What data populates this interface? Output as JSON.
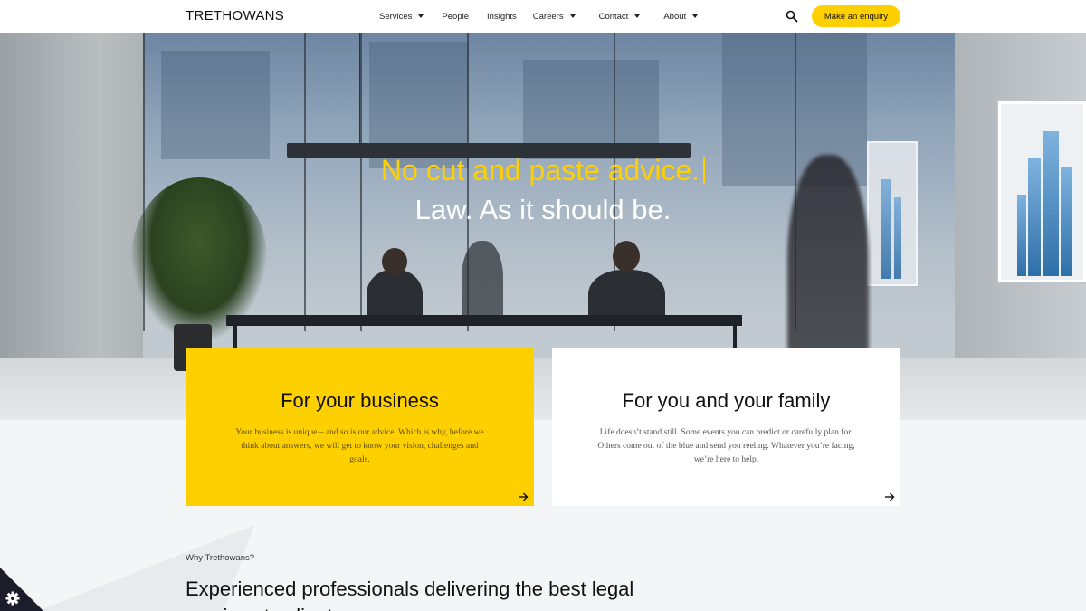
{
  "header": {
    "logo": "TRETHOWANS",
    "nav": [
      {
        "label": "Services",
        "dropdown": true
      },
      {
        "label": "People",
        "dropdown": false
      },
      {
        "label": "Insights",
        "dropdown": false
      },
      {
        "label": "Careers",
        "dropdown": true
      },
      {
        "label": "Contact",
        "dropdown": true
      },
      {
        "label": "About",
        "dropdown": true
      }
    ],
    "search_icon": "search-icon",
    "cta_label": "Make an enquiry"
  },
  "hero": {
    "line1": "No cut and paste advice.",
    "line2": "Law. As it should be."
  },
  "cards": {
    "business": {
      "title": "For your business",
      "text": "Your business is unique – and so is our advice. Which is why, before we think about answers, we will get to know your vision, challenges and goals."
    },
    "family": {
      "title": "For you and your family",
      "text": "Life doesn’t stand still. Some events you can predict or carefully plan for. Others come out of the blue and send you reeling. Whatever you’re facing, we’re here to help."
    }
  },
  "why": {
    "label": "Why Trethowans?",
    "heading": "Experienced professionals delivering the best legal services to clients"
  },
  "colors": {
    "accent": "#ffd000",
    "dark": "#111111",
    "background": "#f4f5f7"
  }
}
